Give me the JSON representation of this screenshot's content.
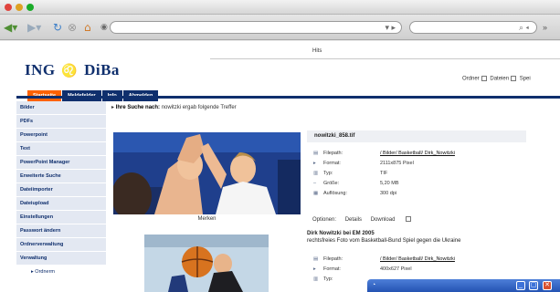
{
  "browser": {
    "back_icon": "back-arrow-icon",
    "forward_icon": "forward-arrow-icon",
    "reload_icon": "reload-icon",
    "stop_icon": "stop-icon",
    "home_icon": "home-icon"
  },
  "page": {
    "top_tab_label": "Hits",
    "logo": {
      "ing": "ING",
      "diba": "DiBa"
    },
    "search_options": [
      {
        "label": "Ordner",
        "checked": true
      },
      {
        "label": "Dateien",
        "checked": true
      },
      {
        "label": "Spei",
        "checked": true
      }
    ],
    "main_tabs": [
      {
        "label": "Startseite",
        "active": true
      },
      {
        "label": "Meldefelder",
        "active": false
      },
      {
        "label": "Info",
        "active": false
      },
      {
        "label": "Abmelden",
        "active": false
      }
    ],
    "sidebar": [
      "Bilder",
      "PDFs",
      "Powerpoint",
      "Text",
      "PowerPoint Manager",
      "Erweiterte Suche",
      "Dateiimporter",
      "Dateiupload",
      "Einstellungen",
      "Passwort ändern",
      "Ordnerverwaltung",
      "Verwaltung"
    ],
    "sidebar_sub": "Ordnerm",
    "breadcrumb": {
      "prefix": "Ihre Suche nach:",
      "text": "nowitzki ergab folgende Treffer"
    },
    "result1": {
      "title": "nowitzki_858.tif",
      "caption": "Merken",
      "meta": [
        {
          "key": "Filepath:",
          "value": "/ Bilder/ Basketball/ Dirk_Nowitzki",
          "link": true
        },
        {
          "key": "Format:",
          "value": "2111x875 Pixel",
          "link": false
        },
        {
          "key": "Typ:",
          "value": "TIF",
          "link": false
        },
        {
          "key": "Größe:",
          "value": "5,20 MB",
          "link": false
        },
        {
          "key": "Auflösung:",
          "value": "300 dpi",
          "link": false
        }
      ],
      "options": [
        "Optionen:",
        "Details",
        "Download"
      ]
    },
    "result2": {
      "title": "Dirk Nowitzki bei EM 2005",
      "desc": "rechtsfreies Foto vom Basketball-Bund Spiel gegen die Ukraine",
      "meta": [
        {
          "key": "Filepath:",
          "value": "/ Bilder/ Basketball/ Dirk_Nowitzki",
          "link": true
        },
        {
          "key": "Format:",
          "value": "400x627 Pixel",
          "link": false
        },
        {
          "key": "Typ:",
          "value": "",
          "link": false
        }
      ]
    }
  },
  "colors": {
    "brand_navy": "#0f2f6d",
    "brand_orange": "#ff6200"
  }
}
